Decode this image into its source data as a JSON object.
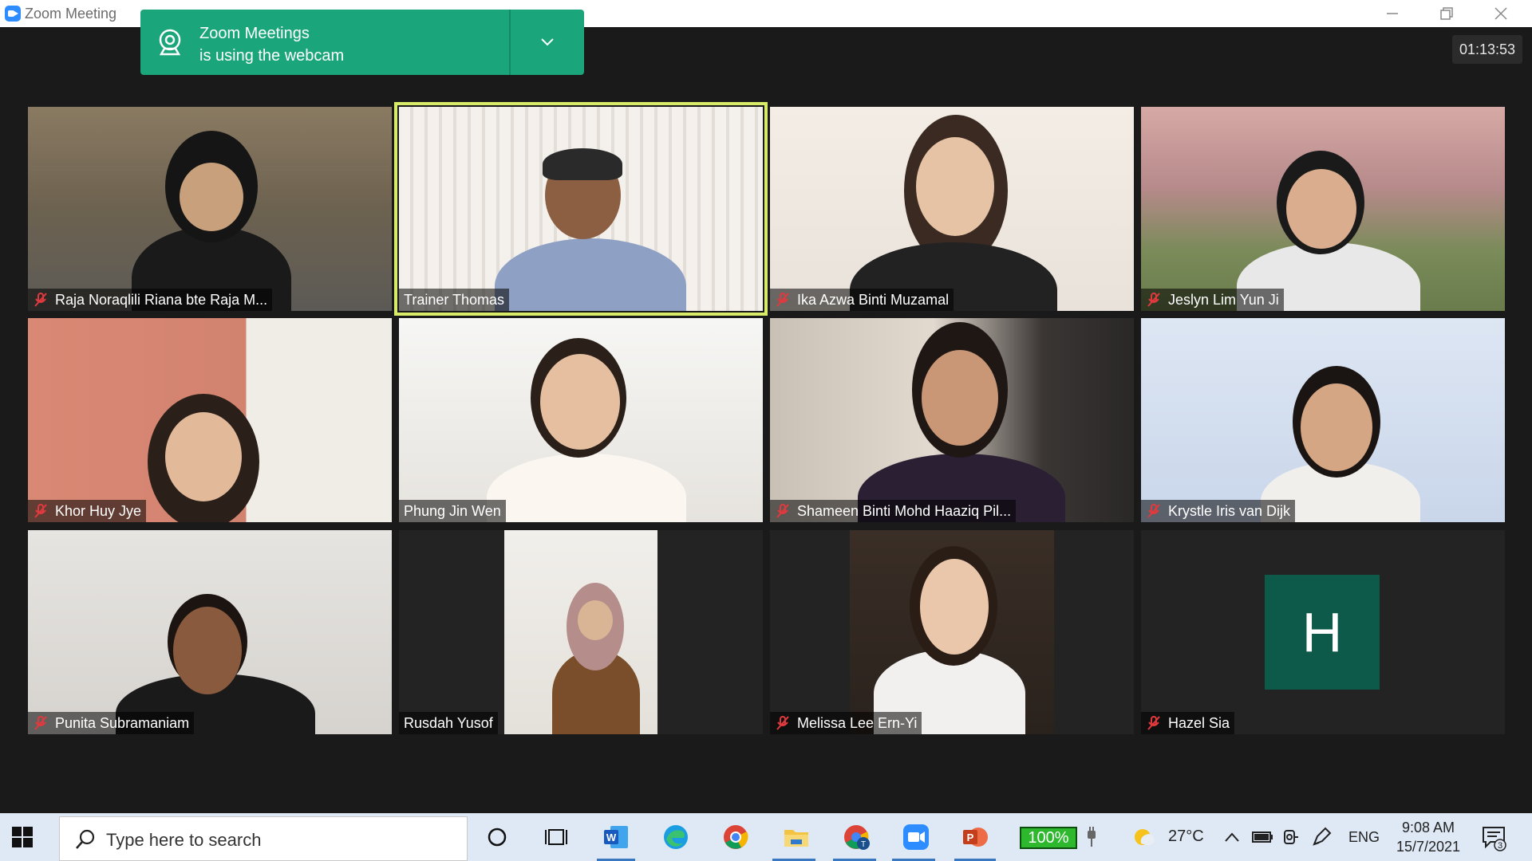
{
  "window": {
    "title": "Zoom Meeting",
    "controls": [
      "minimize",
      "restore",
      "close"
    ]
  },
  "notification": {
    "line1": "Zoom Meetings",
    "line2": "is using the webcam",
    "icon": "webcam-icon"
  },
  "meeting": {
    "timer": "01:13:53",
    "active_speaker": "Trainer Thomas"
  },
  "participants": [
    {
      "name": "Raja Noraqlili Riana bte Raja M...",
      "muted": true
    },
    {
      "name": "Trainer Thomas",
      "muted": false
    },
    {
      "name": "Ika Azwa Binti Muzamal",
      "muted": true
    },
    {
      "name": "Jeslyn Lim Yun Ji",
      "muted": true
    },
    {
      "name": "Khor Huy Jye",
      "muted": true
    },
    {
      "name": "Phung Jin Wen",
      "muted": false
    },
    {
      "name": "Shameen Binti Mohd Haaziq Pil...",
      "muted": true
    },
    {
      "name": "Krystle Iris van Dijk",
      "muted": true
    },
    {
      "name": "Punita Subramaniam",
      "muted": true
    },
    {
      "name": "Rusdah Yusof",
      "muted": false
    },
    {
      "name": "Melissa Lee Ern-Yi",
      "muted": true
    },
    {
      "name": "Hazel Sia",
      "muted": true,
      "avatar_letter": "H"
    }
  ],
  "taskbar": {
    "search_placeholder": "Type here to search",
    "battery": "100%",
    "temperature": "27°C",
    "language": "ENG",
    "time": "9:08 AM",
    "date": "15/7/2021",
    "notification_count": "3"
  },
  "colors": {
    "notification_green": "#1aa67a",
    "active_border": "#d8ec6a",
    "muted_red": "#e0393e",
    "avatar_bg": "#0e5a4a"
  }
}
